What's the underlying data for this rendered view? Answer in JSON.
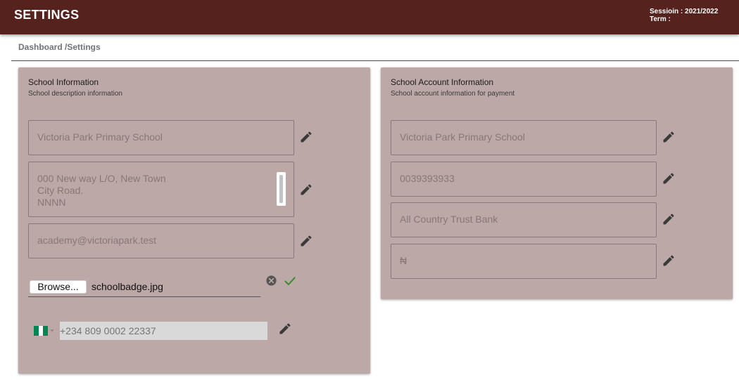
{
  "header": {
    "title": "SETTINGS",
    "session_line": "Sessioin : 2021/2022",
    "term_line": "Term :"
  },
  "breadcrumb": "Dashboard /Settings",
  "school_info": {
    "title": "School Information",
    "subtitle": "School description information",
    "school_name": "Victoria Park Primary School",
    "address": "000 New way L/O, New Town\nCity Road.\nNNNN",
    "email": "academy@victoriapark.test",
    "browse_label": "Browse...",
    "file_name": "schoolbadge.jpg",
    "phone_placeholder": "+234 809 0002 22337",
    "flag_colors": [
      "#008751",
      "#ffffff",
      "#008751"
    ]
  },
  "account_info": {
    "title": "School Account Information",
    "subtitle": "School account information for payment",
    "account_name": "Victoria Park Primary School",
    "account_number": "0039393933",
    "bank_name": "All Country Trust Bank",
    "currency_symbol": "₦"
  },
  "colors": {
    "header_bg": "#55221d",
    "card_bg": "#bca8a7",
    "confirm_check": "#3a8c2a"
  }
}
